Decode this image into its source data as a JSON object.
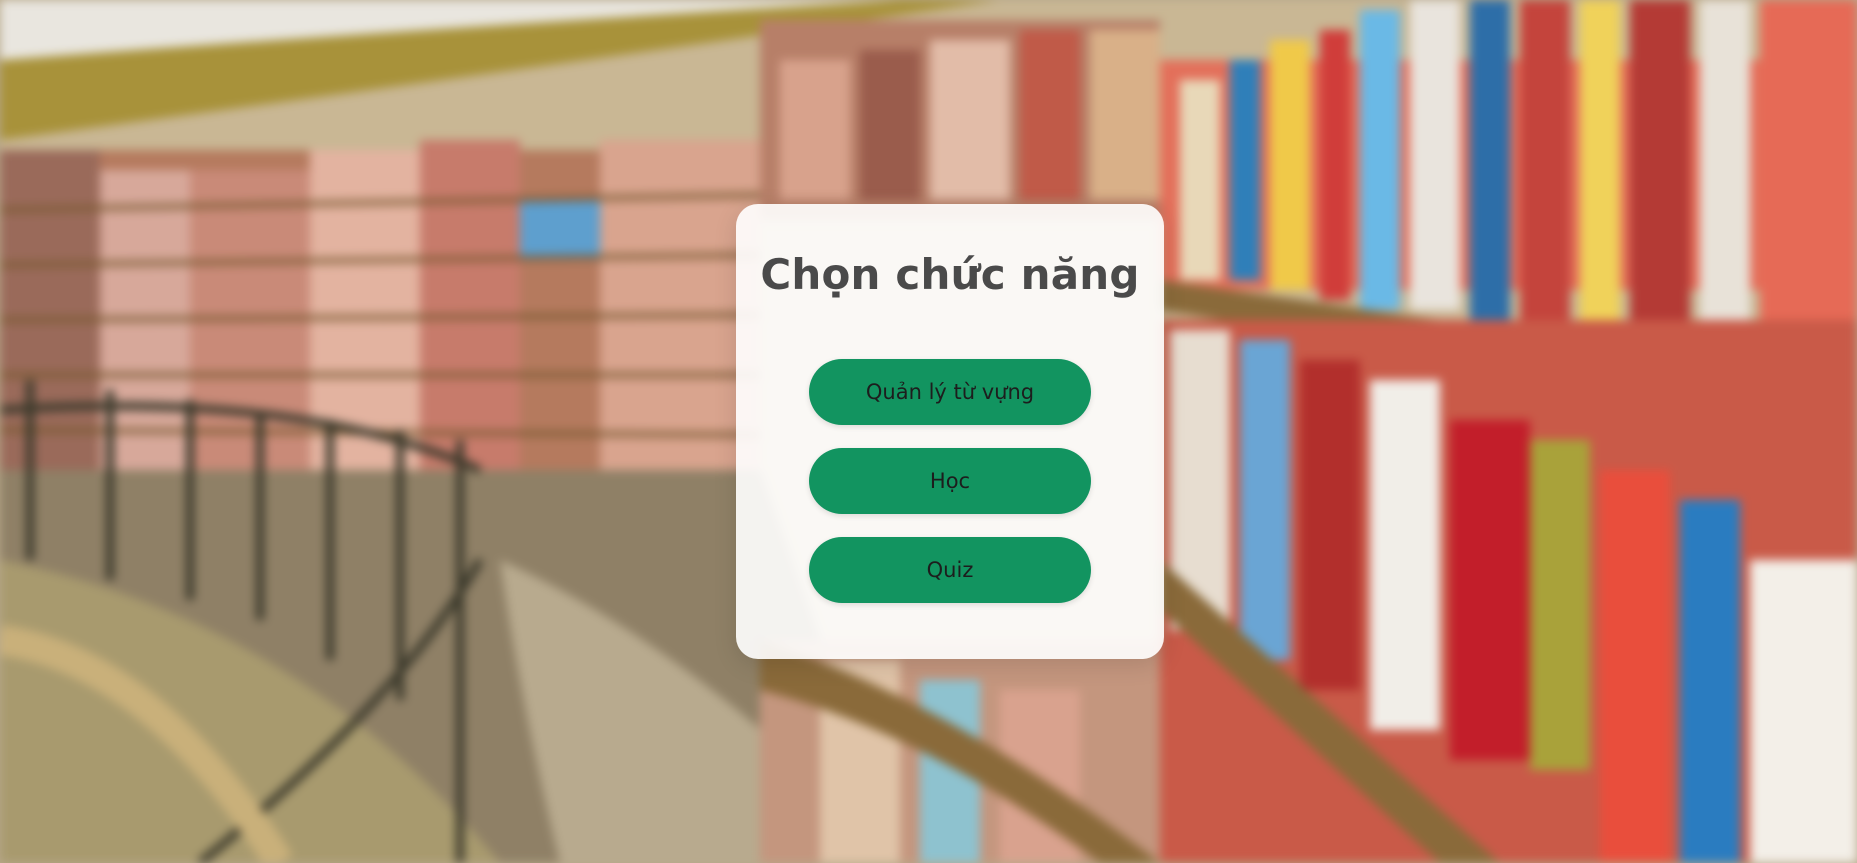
{
  "card": {
    "title": "Chọn chức năng"
  },
  "menu": {
    "buttons": [
      {
        "label": "Quản lý từ vựng"
      },
      {
        "label": "Học"
      },
      {
        "label": "Quiz"
      }
    ]
  },
  "colors": {
    "button_bg": "#129460",
    "button_text": "#1d1d1d",
    "title": "#4a4a4a",
    "card_bg": "#ffffff"
  }
}
